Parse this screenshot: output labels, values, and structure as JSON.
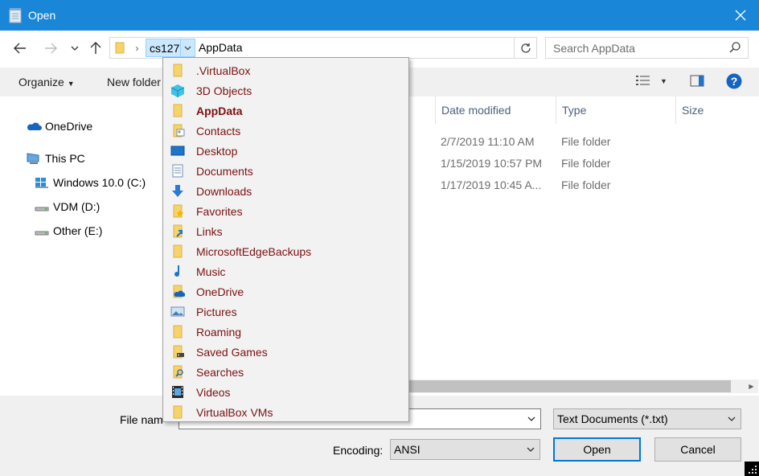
{
  "window": {
    "title": "Open"
  },
  "address": {
    "crumb": "cs127",
    "current": "AppData"
  },
  "search": {
    "placeholder": "Search AppData"
  },
  "toolbar": {
    "organize": "Organize",
    "new_folder": "New folder"
  },
  "nav_pane": [
    {
      "label": "OneDrive",
      "icon": "onedrive-cloud-icon"
    },
    {
      "label": "This PC",
      "icon": "pc-icon"
    },
    {
      "label": "Windows 10.0 (C:)",
      "icon": "windows-drive-icon"
    },
    {
      "label": "VDM (D:)",
      "icon": "drive-icon"
    },
    {
      "label": "Other (E:)",
      "icon": "drive-icon"
    }
  ],
  "columns": {
    "date_modified": "Date modified",
    "type": "Type",
    "size": "Size"
  },
  "rows": [
    {
      "date": "2/7/2019 11:10 AM",
      "type": "File folder"
    },
    {
      "date": "1/15/2019 10:57 PM",
      "type": "File folder"
    },
    {
      "date": "1/17/2019 10:45 A...",
      "type": "File folder"
    }
  ],
  "dropdown": [
    {
      "label": ".VirtualBox",
      "icon": "folder-icon"
    },
    {
      "label": "3D Objects",
      "icon": "3d-objects-icon"
    },
    {
      "label": "AppData",
      "icon": "folder-icon",
      "current": true
    },
    {
      "label": "Contacts",
      "icon": "contacts-icon"
    },
    {
      "label": "Desktop",
      "icon": "desktop-icon"
    },
    {
      "label": "Documents",
      "icon": "documents-icon"
    },
    {
      "label": "Downloads",
      "icon": "downloads-icon"
    },
    {
      "label": "Favorites",
      "icon": "favorites-icon"
    },
    {
      "label": "Links",
      "icon": "links-icon"
    },
    {
      "label": "MicrosoftEdgeBackups",
      "icon": "folder-icon"
    },
    {
      "label": "Music",
      "icon": "music-icon"
    },
    {
      "label": "OneDrive",
      "icon": "onedrive-folder-icon"
    },
    {
      "label": "Pictures",
      "icon": "pictures-icon"
    },
    {
      "label": "Roaming",
      "icon": "folder-icon"
    },
    {
      "label": "Saved Games",
      "icon": "saved-games-icon"
    },
    {
      "label": "Searches",
      "icon": "searches-icon"
    },
    {
      "label": "Videos",
      "icon": "videos-icon"
    },
    {
      "label": "VirtualBox VMs",
      "icon": "folder-icon"
    }
  ],
  "bottom": {
    "file_name_label": "File nam",
    "file_name_value": "",
    "file_type": "Text Documents (*.txt)",
    "encoding_label": "Encoding:",
    "encoding_value": "ANSI",
    "open": "Open",
    "cancel": "Cancel"
  },
  "colors": {
    "titlebar": "#1a86d8",
    "folder": "#f7d36b",
    "dropdown_text": "#7c1010",
    "crumb_highlight": "#cce8ff"
  }
}
